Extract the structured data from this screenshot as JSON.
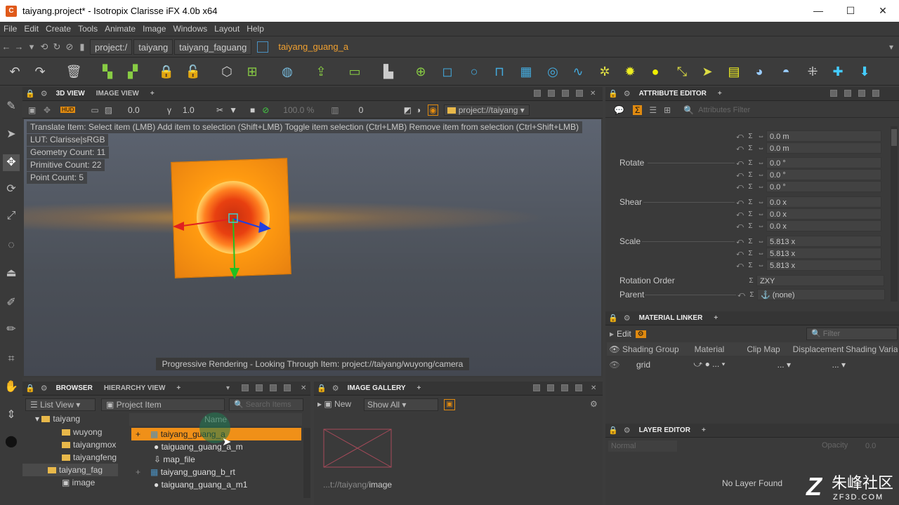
{
  "window": {
    "title": "taiyang.project* - Isotropix Clarisse iFX 4.0b x64",
    "app_icon": "C",
    "minimize": "—",
    "maximize": "☐",
    "close": "✕"
  },
  "menu": [
    "File",
    "Edit",
    "Create",
    "Tools",
    "Animate",
    "Image",
    "Windows",
    "Layout",
    "Help"
  ],
  "path": {
    "crumbs": [
      "project:/",
      "taiyang",
      "taiyang_faguang"
    ],
    "current": "taiyang_guang_a"
  },
  "viewport": {
    "tabs": [
      "3D VIEW",
      "IMAGE VIEW"
    ],
    "toolbar": {
      "field1": "0.0",
      "field2": "1.0",
      "percent": "100.0 %",
      "frame": "0",
      "context": "project://taiyang"
    },
    "help": "Translate Item: Select item (LMB)  Add item to selection (Shift+LMB)  Toggle item selection (Ctrl+LMB)  Remove item from selection (Ctrl+Shift+LMB)",
    "info": [
      "LUT: Clarisse|sRGB",
      "Geometry Count: 11",
      "Primitive Count: 22",
      "Point Count: 5"
    ],
    "progress": "Progressive Rendering - Looking Through Item: project://taiyang/wuyong/camera"
  },
  "attribute_editor": {
    "title": "ATTRIBUTE EDITOR",
    "filter_placeholder": "Attributes Filter",
    "translate_values": [
      "0.0 m",
      "0.0 m"
    ],
    "rotate_label": "Rotate",
    "rotate_values": [
      "0.0 °",
      "0.0 °",
      "0.0 °"
    ],
    "shear_label": "Shear",
    "shear_values": [
      "0.0 x",
      "0.0 x",
      "0.0 x"
    ],
    "scale_label": "Scale",
    "scale_values": [
      "5.813 x",
      "5.813 x",
      "5.813 x"
    ],
    "rotation_order_label": "Rotation Order",
    "rotation_order": "ZXY",
    "parent_label": "Parent",
    "parent": "(none)"
  },
  "material_linker": {
    "title": "MATERIAL LINKER",
    "edit": "Edit",
    "filter_placeholder": "Filter",
    "columns": [
      "Shading Group",
      "Material",
      "Clip Map",
      "Displacement",
      "Shading Variable"
    ],
    "row": {
      "name": "grid",
      "material": "...",
      "clip": "...",
      "disp": "..."
    }
  },
  "layer_editor": {
    "title": "LAYER EDITOR",
    "mode": "Normal",
    "opacity_label": "Opacity",
    "opacity": "0.0",
    "empty": "No Layer Found"
  },
  "browser": {
    "tabs": [
      "BROWSER",
      "HIERARCHY VIEW"
    ],
    "view_mode": "List View",
    "filter": "Project Item",
    "search_placeholder": "Search Items",
    "tree": [
      "taiyang",
      "wuyong",
      "taiyangmox",
      "taiyangfeng",
      "taiyang_fag",
      "image"
    ],
    "column": "Name",
    "items": [
      "taiyang_guang_a",
      "taiguang_guang_a_m",
      "map_file",
      "taiyang_guang_b_rt",
      "taiguang_guang_a_m1"
    ]
  },
  "gallery": {
    "title": "IMAGE GALLERY",
    "new": "New",
    "show": "Show All",
    "image_path": "...t://taiyang/",
    "image_name": "image"
  },
  "watermark": {
    "brand": "朱峰社区",
    "url": "ZF3D.COM"
  },
  "colors": {
    "accent": "#f09018",
    "panel": "#3a3a3a",
    "title_bg": "#ffffff"
  }
}
